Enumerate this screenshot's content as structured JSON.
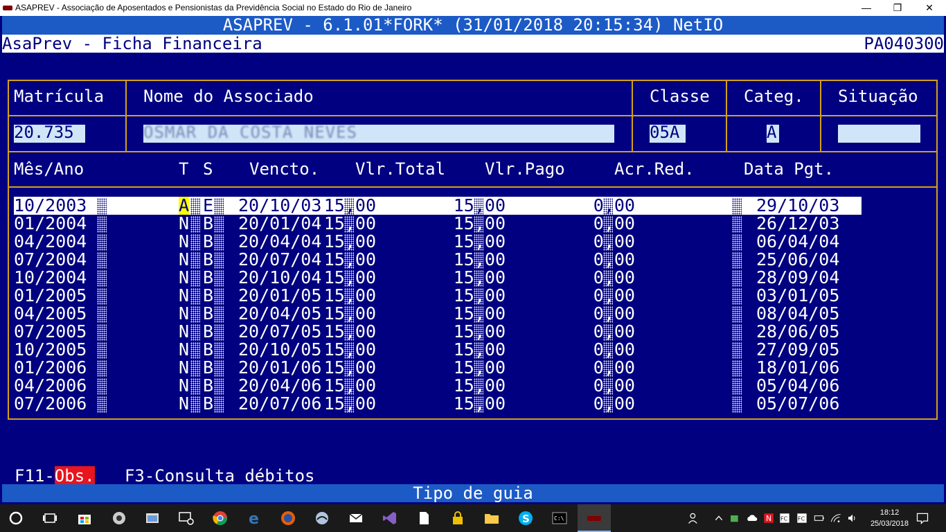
{
  "window": {
    "title": "ASAPREV - Associação de Aposentados e Pensionistas da Previdência Social no Estado do Rio de Janeiro",
    "minimize": "—",
    "maximize": "❐",
    "close": "✕"
  },
  "terminal": {
    "header_line": "ASAPREV - 6.1.01*FORK* (31/01/2018 20:15:34) NetIO",
    "screen_title": "AsaPrev - Ficha Financeira",
    "screen_code": "PA040300",
    "labels": {
      "matricula": "Matrícula",
      "nome": "Nome do Associado",
      "classe": "Classe",
      "categ": "Categ.",
      "situacao": "Situação"
    },
    "values": {
      "matricula": "20.735",
      "nome": "OSMAR DA COSTA NEVES",
      "classe": "05A",
      "categ": "A",
      "situacao": ""
    },
    "columns": {
      "mes_ano": "Mês/Ano",
      "t": "T",
      "s": "S",
      "vencto": "Vencto.",
      "vlr_total": "Vlr.Total",
      "vlr_pago": "Vlr.Pago",
      "acr_red": "Acr.Red.",
      "data_pgt": "Data Pgt."
    },
    "rows": [
      {
        "mes": "10/2003",
        "t": "A",
        "s": "E",
        "vencto": "20/10/03",
        "total": "15,00",
        "pago": "15,00",
        "acr": "0,00",
        "pgt": "29/10/03"
      },
      {
        "mes": "01/2004",
        "t": "N",
        "s": "B",
        "vencto": "20/01/04",
        "total": "15,00",
        "pago": "15,00",
        "acr": "0,00",
        "pgt": "26/12/03"
      },
      {
        "mes": "04/2004",
        "t": "N",
        "s": "B",
        "vencto": "20/04/04",
        "total": "15,00",
        "pago": "15,00",
        "acr": "0,00",
        "pgt": "06/04/04"
      },
      {
        "mes": "07/2004",
        "t": "N",
        "s": "B",
        "vencto": "20/07/04",
        "total": "15,00",
        "pago": "15,00",
        "acr": "0,00",
        "pgt": "25/06/04"
      },
      {
        "mes": "10/2004",
        "t": "N",
        "s": "B",
        "vencto": "20/10/04",
        "total": "15,00",
        "pago": "15,00",
        "acr": "0,00",
        "pgt": "28/09/04"
      },
      {
        "mes": "01/2005",
        "t": "N",
        "s": "B",
        "vencto": "20/01/05",
        "total": "15,00",
        "pago": "15,00",
        "acr": "0,00",
        "pgt": "03/01/05"
      },
      {
        "mes": "04/2005",
        "t": "N",
        "s": "B",
        "vencto": "20/04/05",
        "total": "15,00",
        "pago": "15,00",
        "acr": "0,00",
        "pgt": "08/04/05"
      },
      {
        "mes": "07/2005",
        "t": "N",
        "s": "B",
        "vencto": "20/07/05",
        "total": "15,00",
        "pago": "15,00",
        "acr": "0,00",
        "pgt": "28/06/05"
      },
      {
        "mes": "10/2005",
        "t": "N",
        "s": "B",
        "vencto": "20/10/05",
        "total": "15,00",
        "pago": "15,00",
        "acr": "0,00",
        "pgt": "27/09/05"
      },
      {
        "mes": "01/2006",
        "t": "N",
        "s": "B",
        "vencto": "20/01/06",
        "total": "15,00",
        "pago": "15,00",
        "acr": "0,00",
        "pgt": "18/01/06"
      },
      {
        "mes": "04/2006",
        "t": "N",
        "s": "B",
        "vencto": "20/04/06",
        "total": "15,00",
        "pago": "15,00",
        "acr": "0,00",
        "pgt": "05/04/06"
      },
      {
        "mes": "07/2006",
        "t": "N",
        "s": "B",
        "vencto": "20/07/06",
        "total": "15,00",
        "pago": "15,00",
        "acr": "0,00",
        "pgt": "05/07/06"
      }
    ],
    "fkeys": {
      "f11_prefix": "F11-",
      "f11_label": "Obs.",
      "f3": "F3-Consulta débitos"
    },
    "status": "Tipo de guia"
  },
  "taskbar": {
    "clock_time": "18:12",
    "clock_date": "25/03/2018",
    "icons": [
      "start-icon",
      "task-view-icon",
      "store-icon",
      "app-icon",
      "explorer-icon",
      "devices-icon",
      "chrome-icon",
      "edge-icon",
      "firefox-icon",
      "outlook-icon",
      "mail-icon",
      "visual-studio-icon",
      "file-icon",
      "lock-icon",
      "folder-icon",
      "skype-icon",
      "cmd-icon",
      "asaprev-icon"
    ],
    "tray_icons": [
      "people-icon",
      "chevron-up-icon",
      "cloud-icon",
      "upload-icon",
      "notes-icon",
      "fc-icon",
      "fc2-icon",
      "battery-icon",
      "wifi-icon",
      "volume-icon",
      "notifications-icon"
    ],
    "colors": {
      "accent": "#1c5ac6",
      "background": "#000080",
      "border": "#d4a017",
      "highlight": "#ffff00",
      "obs": "#e8141e"
    }
  }
}
